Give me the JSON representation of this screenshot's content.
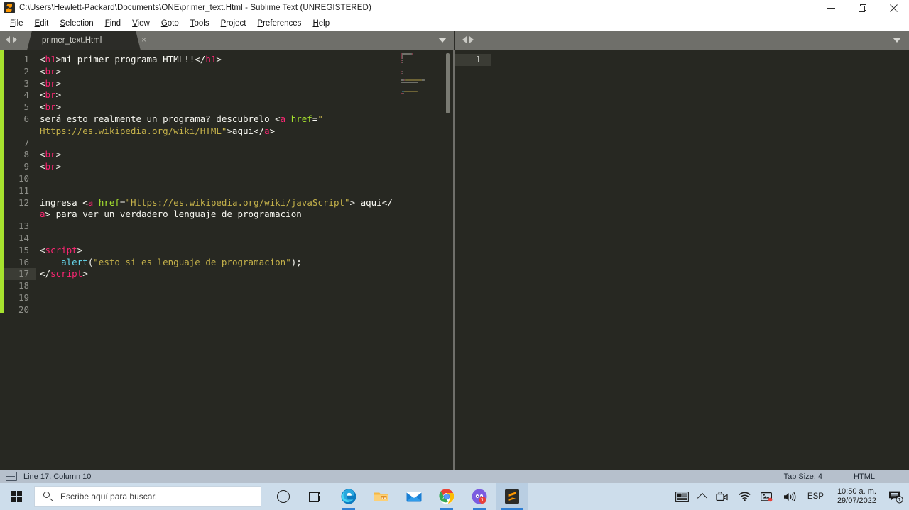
{
  "window": {
    "title": "C:\\Users\\Hewlett-Packard\\Documents\\ONE\\primer_text.Html - Sublime Text (UNREGISTERED)",
    "app_icon": "sublime-text-icon",
    "minimize_label": "—",
    "maximize_label": "❐",
    "close_label": "✕"
  },
  "menu": {
    "items": [
      {
        "label": "File"
      },
      {
        "label": "Edit"
      },
      {
        "label": "Selection"
      },
      {
        "label": "Find"
      },
      {
        "label": "View"
      },
      {
        "label": "Goto"
      },
      {
        "label": "Tools"
      },
      {
        "label": "Project"
      },
      {
        "label": "Preferences"
      },
      {
        "label": "Help"
      }
    ]
  },
  "tabs": {
    "left_pane": {
      "label": "primer_text.Html",
      "close": "×"
    },
    "dropdown_glyph": "▼"
  },
  "editor": {
    "left_pane": {
      "current_line": 17,
      "lines": [
        {
          "n": 1,
          "tokens": [
            {
              "t": "punct",
              "s": "<"
            },
            {
              "t": "tag",
              "s": "h1"
            },
            {
              "t": "punct",
              "s": ">"
            },
            {
              "t": "plain",
              "s": "mi primer programa HTML!!"
            },
            {
              "t": "punct",
              "s": "</"
            },
            {
              "t": "tag",
              "s": "h1"
            },
            {
              "t": "punct",
              "s": ">"
            }
          ]
        },
        {
          "n": 2,
          "tokens": [
            {
              "t": "punct",
              "s": "<"
            },
            {
              "t": "tag",
              "s": "br"
            },
            {
              "t": "punct",
              "s": ">"
            }
          ]
        },
        {
          "n": 3,
          "tokens": [
            {
              "t": "punct",
              "s": "<"
            },
            {
              "t": "tag",
              "s": "br"
            },
            {
              "t": "punct",
              "s": ">"
            }
          ]
        },
        {
          "n": 4,
          "tokens": [
            {
              "t": "punct",
              "s": "<"
            },
            {
              "t": "tag",
              "s": "br"
            },
            {
              "t": "punct",
              "s": ">"
            }
          ]
        },
        {
          "n": 5,
          "tokens": [
            {
              "t": "punct",
              "s": "<"
            },
            {
              "t": "tag",
              "s": "br"
            },
            {
              "t": "punct",
              "s": ">"
            }
          ]
        },
        {
          "n": 6,
          "tokens": [
            {
              "t": "plain",
              "s": "será esto realmente un programa? descubrelo "
            },
            {
              "t": "punct",
              "s": "<"
            },
            {
              "t": "tag",
              "s": "a"
            },
            {
              "t": "plain",
              "s": " "
            },
            {
              "t": "attr",
              "s": "href"
            },
            {
              "t": "punct",
              "s": "="
            },
            {
              "t": "str",
              "s": "\""
            }
          ]
        },
        {
          "n": "",
          "wrap": true,
          "tokens": [
            {
              "t": "str",
              "s": "Https://es.wikipedia.org/wiki/HTML\""
            },
            {
              "t": "plain",
              "s": ">aqui"
            },
            {
              "t": "punct",
              "s": "</"
            },
            {
              "t": "tag",
              "s": "a"
            },
            {
              "t": "punct",
              "s": ">"
            }
          ]
        },
        {
          "n": 7,
          "tokens": []
        },
        {
          "n": 8,
          "tokens": [
            {
              "t": "punct",
              "s": "<"
            },
            {
              "t": "tag",
              "s": "br"
            },
            {
              "t": "punct",
              "s": ">"
            }
          ]
        },
        {
          "n": 9,
          "tokens": [
            {
              "t": "punct",
              "s": "<"
            },
            {
              "t": "tag",
              "s": "br"
            },
            {
              "t": "punct",
              "s": ">"
            }
          ]
        },
        {
          "n": 10,
          "tokens": []
        },
        {
          "n": 11,
          "tokens": []
        },
        {
          "n": 12,
          "tokens": [
            {
              "t": "plain",
              "s": "ingresa "
            },
            {
              "t": "punct",
              "s": "<"
            },
            {
              "t": "tag",
              "s": "a"
            },
            {
              "t": "plain",
              "s": " "
            },
            {
              "t": "attr",
              "s": "href"
            },
            {
              "t": "punct",
              "s": "="
            },
            {
              "t": "str",
              "s": "\"Https://es.wikipedia.org/wiki/javaScript\""
            },
            {
              "t": "plain",
              "s": "> aqui"
            },
            {
              "t": "punct",
              "s": "</"
            }
          ]
        },
        {
          "n": "",
          "wrap": true,
          "tokens": [
            {
              "t": "tag",
              "s": "a"
            },
            {
              "t": "plain",
              "s": "> para ver un verdadero lenguaje de programacion"
            }
          ]
        },
        {
          "n": 13,
          "tokens": []
        },
        {
          "n": 14,
          "tokens": []
        },
        {
          "n": 15,
          "tokens": [
            {
              "t": "punct",
              "s": "<"
            },
            {
              "t": "tag",
              "s": "script"
            },
            {
              "t": "punct",
              "s": ">"
            }
          ]
        },
        {
          "n": 16,
          "indent": true,
          "tokens": [
            {
              "t": "plain",
              "s": "    "
            },
            {
              "t": "fn",
              "s": "alert"
            },
            {
              "t": "punct",
              "s": "("
            },
            {
              "t": "str",
              "s": "\"esto si es lenguaje de programacion\""
            },
            {
              "t": "punct",
              "s": ");"
            }
          ]
        },
        {
          "n": 17,
          "tokens": [
            {
              "t": "punct",
              "s": "</"
            },
            {
              "t": "tag",
              "s": "script"
            },
            {
              "t": "punct",
              "s": ">"
            }
          ]
        },
        {
          "n": 18,
          "tokens": []
        },
        {
          "n": 19,
          "tokens": []
        },
        {
          "n": 20,
          "tokens": []
        }
      ]
    },
    "right_pane": {
      "line_number": "1"
    }
  },
  "status_bar": {
    "cursor": "Line 17, Column 10",
    "tab_size": "Tab Size: 4",
    "syntax": "HTML"
  },
  "taskbar": {
    "start_icon": "windows-logo-icon",
    "search_placeholder": "Escribe aquí para buscar.",
    "cortana_icon": "cortana-icon",
    "task_view_icon": "task-view-icon",
    "apps": [
      {
        "name": "microsoft-edge-icon"
      },
      {
        "name": "file-explorer-icon"
      },
      {
        "name": "mail-icon"
      },
      {
        "name": "google-chrome-icon"
      },
      {
        "name": "discord-icon",
        "badge": "1"
      },
      {
        "name": "sublime-text-icon",
        "active": true
      }
    ],
    "tray": {
      "news_icon": "news-and-interests-icon",
      "overflow_icon": "show-hidden-icons-chevron",
      "meet_icon": "meet-now-icon",
      "network_icon": "wifi-icon",
      "onedrive_icon": "onedrive-sync-icon",
      "volume_icon": "volume-icon",
      "language": "ESP",
      "time": "10:50 a. m.",
      "date": "29/07/2022",
      "notifications_icon": "action-center-icon",
      "notifications_count": "1"
    }
  },
  "colors": {
    "editor_bg": "#272822",
    "chrome": "#6f6f6a",
    "accent_strip": "#a6e22e",
    "tag": "#f92672",
    "attr": "#a6e22e",
    "string": "#c4b14a",
    "function": "#66d9ef",
    "plain": "#f8f8f2",
    "status_bar": "#b6c0cc",
    "taskbar": "#cdddeb"
  }
}
